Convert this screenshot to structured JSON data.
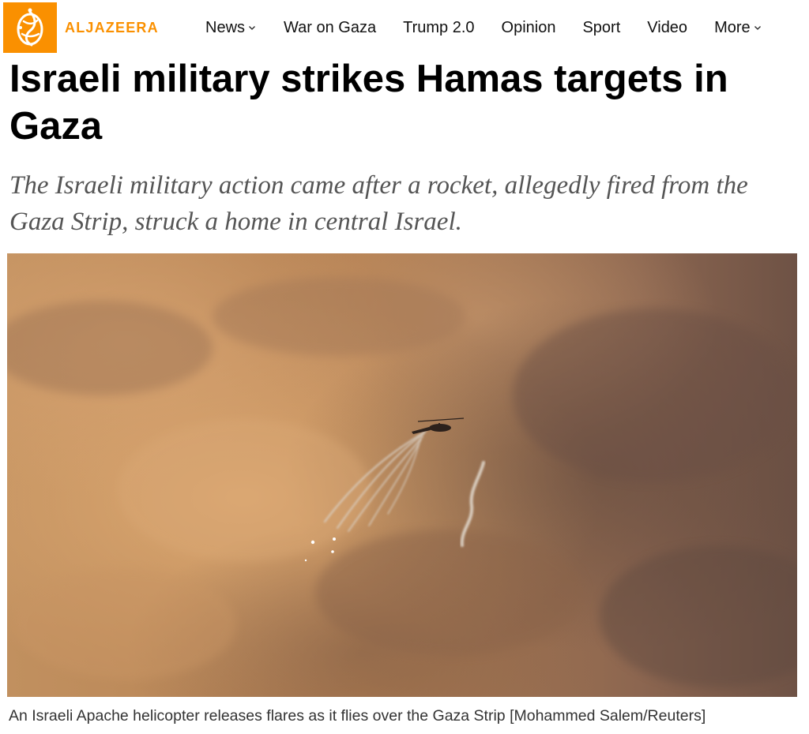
{
  "brand": {
    "name": "ALJAZEERA",
    "color": "#fa9000"
  },
  "nav": {
    "items": [
      {
        "label": "News",
        "has_dropdown": true
      },
      {
        "label": "War on Gaza",
        "has_dropdown": false
      },
      {
        "label": "Trump 2.0",
        "has_dropdown": false
      },
      {
        "label": "Opinion",
        "has_dropdown": false
      },
      {
        "label": "Sport",
        "has_dropdown": false
      },
      {
        "label": "Video",
        "has_dropdown": false
      },
      {
        "label": "More",
        "has_dropdown": true
      }
    ]
  },
  "article": {
    "headline": "Israeli military strikes Hamas targets in Gaza",
    "standfirst": "The Israeli military action came after a rocket, allegedly fired from the Gaza Strip, struck a home in central Israel.",
    "image": {
      "caption": "An Israeli Apache helicopter releases flares as it flies over the Gaza Strip [Mohammed Salem/Reuters]"
    }
  }
}
